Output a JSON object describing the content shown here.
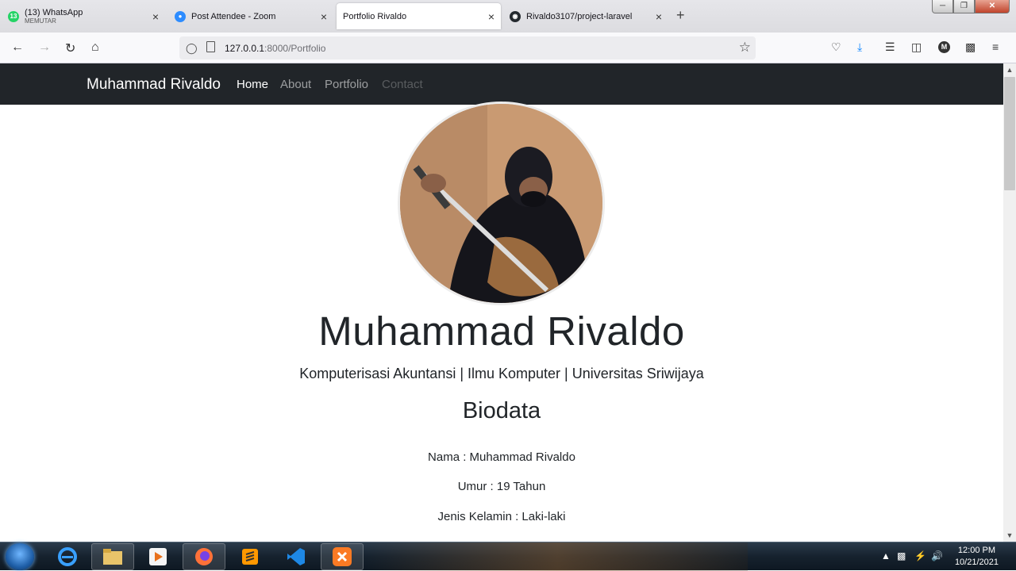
{
  "browser": {
    "tabs": [
      {
        "title": "(13) WhatsApp",
        "subtitle": "MEMUTAR",
        "badge": "13",
        "favicon": "whatsapp-icon",
        "active": false
      },
      {
        "title": "Post Attendee - Zoom",
        "favicon": "zoom-icon",
        "active": false
      },
      {
        "title": "Portfolio Rivaldo",
        "favicon": "",
        "active": true
      },
      {
        "title": "Rivaldo3107/project-laravel",
        "favicon": "github-icon",
        "active": false
      }
    ],
    "close_glyph": "×",
    "new_tab_glyph": "+",
    "url_host": "127.0.0.1",
    "url_rest": ":8000/Portfolio",
    "account_initial": "M"
  },
  "site": {
    "brand": "Muhammad Rivaldo",
    "nav": [
      {
        "label": "Home",
        "state": "active"
      },
      {
        "label": "About",
        "state": "normal"
      },
      {
        "label": "Portfolio",
        "state": "normal"
      },
      {
        "label": "Contact",
        "state": "disabled"
      }
    ],
    "hero_name": "Muhammad Rivaldo",
    "hero_subtitle": "Komputerisasi Akuntansi | Ilmu Komputer | Universitas Sriwijaya",
    "section_title": "Biodata",
    "bio": [
      "Nama : Muhammad Rivaldo",
      "Umur : 19 Tahun",
      "Jenis Kelamin : Laki-laki"
    ]
  },
  "taskbar": {
    "time": "12:00 PM",
    "date": "10/21/2021",
    "apps": [
      "internet-explorer-icon",
      "file-explorer-icon",
      "media-player-icon",
      "firefox-icon",
      "sublime-text-icon",
      "vscode-icon",
      "xampp-icon"
    ]
  },
  "colors": {
    "site_nav_bg": "#212529",
    "text": "#212529",
    "whatsapp": "#25d366",
    "zoom": "#2d8cff",
    "firefox": "#ff7139",
    "vscode": "#1e88e5",
    "sublime": "#ff9800",
    "xampp": "#fb7a24"
  }
}
